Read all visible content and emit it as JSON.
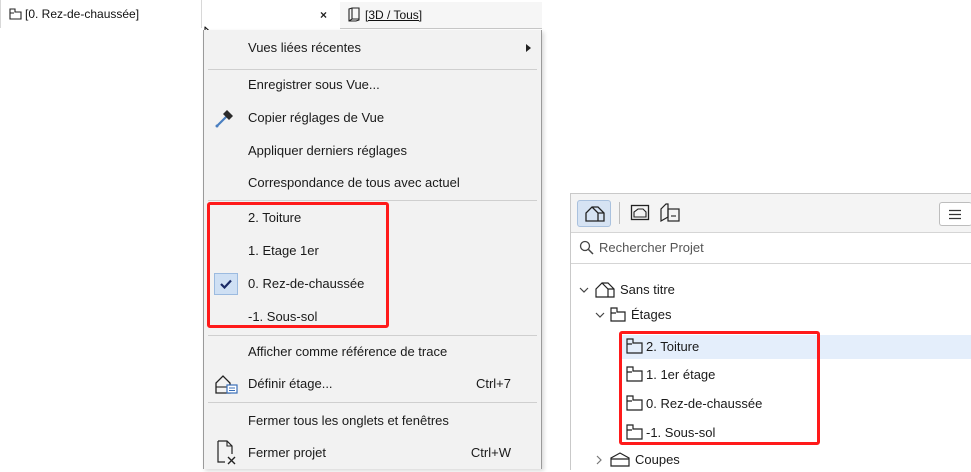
{
  "tabs": {
    "active_label": "[0. Rez-de-chaussée]",
    "close_glyph": "×",
    "inactive_label": "[3D / Tous]"
  },
  "context_menu": {
    "recent_views": "Vues liées récentes",
    "save_as_view": "Enregistrer sous Vue...",
    "copy_view_settings": "Copier réglages de Vue",
    "apply_last_settings": "Appliquer derniers réglages",
    "match_all_current": "Correspondance de tous avec actuel",
    "stories": [
      {
        "label": "2. Toiture",
        "checked": false
      },
      {
        "label": "1. Etage 1er",
        "checked": false
      },
      {
        "label": "0. Rez-de-chaussée",
        "checked": true
      },
      {
        "label": "-1. Sous-sol",
        "checked": false
      }
    ],
    "show_as_trace": "Afficher comme référence de trace",
    "define_story": "Définir étage...",
    "define_story_shortcut": "Ctrl+7",
    "close_all_tabs": "Fermer tous les onglets et fenêtres",
    "close_project": "Fermer projet",
    "close_project_shortcut": "Ctrl+W"
  },
  "navigator": {
    "search_placeholder": "Rechercher Projet",
    "root_label": "Sans titre",
    "stories_folder": "Étages",
    "stories": [
      "2. Toiture",
      "1. 1er étage",
      "0. Rez-de-chaussée",
      "-1. Sous-sol"
    ],
    "sections_folder": "Coupes"
  },
  "colors": {
    "highlight_red": "#ff1a1a",
    "selection_blue": "#e4eefb",
    "menu_bg": "#f2f2f2"
  }
}
